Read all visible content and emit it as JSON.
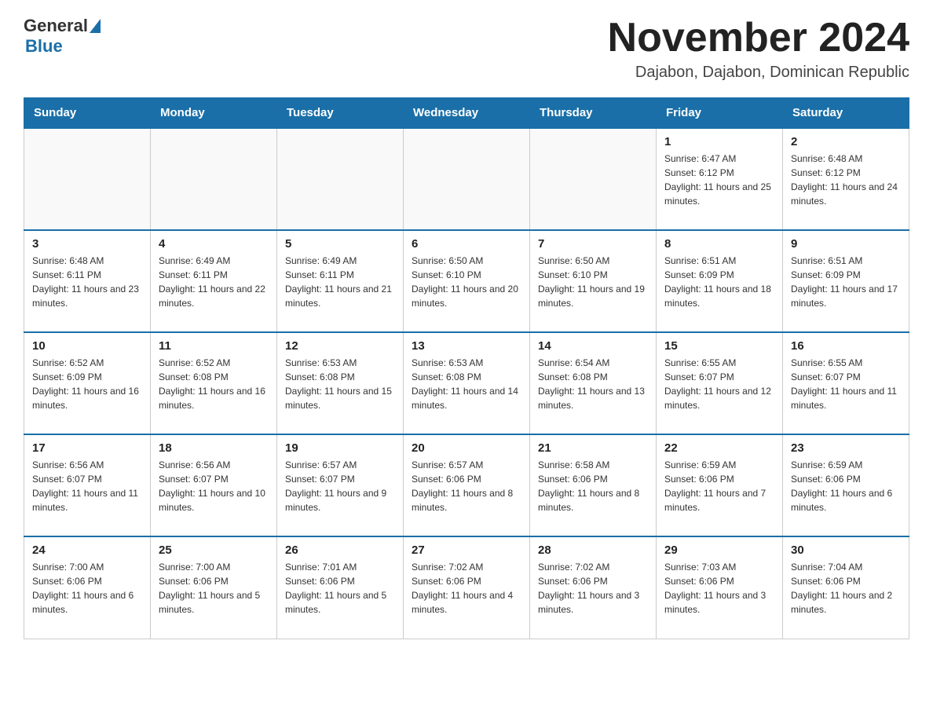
{
  "header": {
    "logo_general": "General",
    "logo_blue": "Blue",
    "title": "November 2024",
    "subtitle": "Dajabon, Dajabon, Dominican Republic"
  },
  "days_of_week": [
    "Sunday",
    "Monday",
    "Tuesday",
    "Wednesday",
    "Thursday",
    "Friday",
    "Saturday"
  ],
  "weeks": [
    [
      {
        "day": "",
        "info": ""
      },
      {
        "day": "",
        "info": ""
      },
      {
        "day": "",
        "info": ""
      },
      {
        "day": "",
        "info": ""
      },
      {
        "day": "",
        "info": ""
      },
      {
        "day": "1",
        "info": "Sunrise: 6:47 AM\nSunset: 6:12 PM\nDaylight: 11 hours and 25 minutes."
      },
      {
        "day": "2",
        "info": "Sunrise: 6:48 AM\nSunset: 6:12 PM\nDaylight: 11 hours and 24 minutes."
      }
    ],
    [
      {
        "day": "3",
        "info": "Sunrise: 6:48 AM\nSunset: 6:11 PM\nDaylight: 11 hours and 23 minutes."
      },
      {
        "day": "4",
        "info": "Sunrise: 6:49 AM\nSunset: 6:11 PM\nDaylight: 11 hours and 22 minutes."
      },
      {
        "day": "5",
        "info": "Sunrise: 6:49 AM\nSunset: 6:11 PM\nDaylight: 11 hours and 21 minutes."
      },
      {
        "day": "6",
        "info": "Sunrise: 6:50 AM\nSunset: 6:10 PM\nDaylight: 11 hours and 20 minutes."
      },
      {
        "day": "7",
        "info": "Sunrise: 6:50 AM\nSunset: 6:10 PM\nDaylight: 11 hours and 19 minutes."
      },
      {
        "day": "8",
        "info": "Sunrise: 6:51 AM\nSunset: 6:09 PM\nDaylight: 11 hours and 18 minutes."
      },
      {
        "day": "9",
        "info": "Sunrise: 6:51 AM\nSunset: 6:09 PM\nDaylight: 11 hours and 17 minutes."
      }
    ],
    [
      {
        "day": "10",
        "info": "Sunrise: 6:52 AM\nSunset: 6:09 PM\nDaylight: 11 hours and 16 minutes."
      },
      {
        "day": "11",
        "info": "Sunrise: 6:52 AM\nSunset: 6:08 PM\nDaylight: 11 hours and 16 minutes."
      },
      {
        "day": "12",
        "info": "Sunrise: 6:53 AM\nSunset: 6:08 PM\nDaylight: 11 hours and 15 minutes."
      },
      {
        "day": "13",
        "info": "Sunrise: 6:53 AM\nSunset: 6:08 PM\nDaylight: 11 hours and 14 minutes."
      },
      {
        "day": "14",
        "info": "Sunrise: 6:54 AM\nSunset: 6:08 PM\nDaylight: 11 hours and 13 minutes."
      },
      {
        "day": "15",
        "info": "Sunrise: 6:55 AM\nSunset: 6:07 PM\nDaylight: 11 hours and 12 minutes."
      },
      {
        "day": "16",
        "info": "Sunrise: 6:55 AM\nSunset: 6:07 PM\nDaylight: 11 hours and 11 minutes."
      }
    ],
    [
      {
        "day": "17",
        "info": "Sunrise: 6:56 AM\nSunset: 6:07 PM\nDaylight: 11 hours and 11 minutes."
      },
      {
        "day": "18",
        "info": "Sunrise: 6:56 AM\nSunset: 6:07 PM\nDaylight: 11 hours and 10 minutes."
      },
      {
        "day": "19",
        "info": "Sunrise: 6:57 AM\nSunset: 6:07 PM\nDaylight: 11 hours and 9 minutes."
      },
      {
        "day": "20",
        "info": "Sunrise: 6:57 AM\nSunset: 6:06 PM\nDaylight: 11 hours and 8 minutes."
      },
      {
        "day": "21",
        "info": "Sunrise: 6:58 AM\nSunset: 6:06 PM\nDaylight: 11 hours and 8 minutes."
      },
      {
        "day": "22",
        "info": "Sunrise: 6:59 AM\nSunset: 6:06 PM\nDaylight: 11 hours and 7 minutes."
      },
      {
        "day": "23",
        "info": "Sunrise: 6:59 AM\nSunset: 6:06 PM\nDaylight: 11 hours and 6 minutes."
      }
    ],
    [
      {
        "day": "24",
        "info": "Sunrise: 7:00 AM\nSunset: 6:06 PM\nDaylight: 11 hours and 6 minutes."
      },
      {
        "day": "25",
        "info": "Sunrise: 7:00 AM\nSunset: 6:06 PM\nDaylight: 11 hours and 5 minutes."
      },
      {
        "day": "26",
        "info": "Sunrise: 7:01 AM\nSunset: 6:06 PM\nDaylight: 11 hours and 5 minutes."
      },
      {
        "day": "27",
        "info": "Sunrise: 7:02 AM\nSunset: 6:06 PM\nDaylight: 11 hours and 4 minutes."
      },
      {
        "day": "28",
        "info": "Sunrise: 7:02 AM\nSunset: 6:06 PM\nDaylight: 11 hours and 3 minutes."
      },
      {
        "day": "29",
        "info": "Sunrise: 7:03 AM\nSunset: 6:06 PM\nDaylight: 11 hours and 3 minutes."
      },
      {
        "day": "30",
        "info": "Sunrise: 7:04 AM\nSunset: 6:06 PM\nDaylight: 11 hours and 2 minutes."
      }
    ]
  ]
}
